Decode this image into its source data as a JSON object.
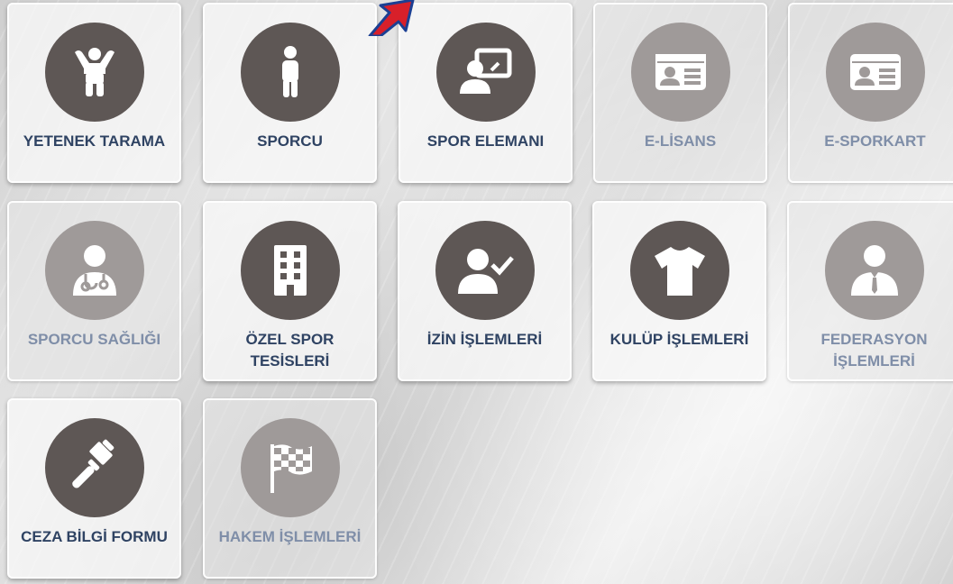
{
  "tiles": [
    {
      "label": "YETENEK TARAMA",
      "icon": "child-icon",
      "enabled": true
    },
    {
      "label": "SPORCU",
      "icon": "person-icon",
      "enabled": true
    },
    {
      "label": "SPOR ELEMANI",
      "icon": "trainer-board-icon",
      "enabled": true
    },
    {
      "label": "E-LİSANS",
      "icon": "id-card-icon",
      "enabled": false
    },
    {
      "label": "E-SPORKART",
      "icon": "id-card-icon",
      "enabled": false
    },
    {
      "label": "SPORCU SAĞLIĞI",
      "icon": "doctor-icon",
      "enabled": false
    },
    {
      "label": "ÖZEL SPOR TESİSLERİ",
      "icon": "building-icon",
      "enabled": true
    },
    {
      "label": "İZİN İŞLEMLERİ",
      "icon": "user-check-icon",
      "enabled": true
    },
    {
      "label": "KULÜP İŞLEMLERİ",
      "icon": "tshirt-icon",
      "enabled": true
    },
    {
      "label": "FEDERASYON İŞLEMLERİ",
      "icon": "businessman-icon",
      "enabled": false
    },
    {
      "label": "CEZA BİLGİ FORMU",
      "icon": "gavel-icon",
      "enabled": true
    },
    {
      "label": "HAKEM İŞLEMLERİ",
      "icon": "checkered-flag-icon",
      "enabled": false
    }
  ],
  "colors": {
    "icon_circle": "#5e5755",
    "icon_circle_disabled": "#9f9a99",
    "label": "#2f4363",
    "label_disabled": "#7f8ea8",
    "arrow": "#d8202a",
    "arrow_outline": "#1b3f93"
  }
}
